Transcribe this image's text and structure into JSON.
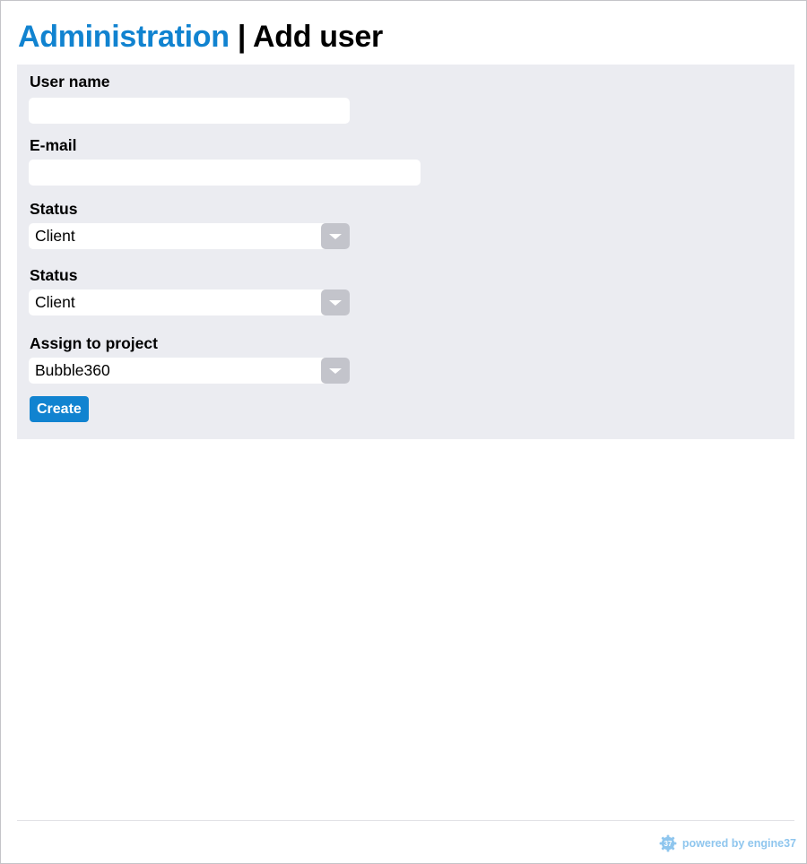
{
  "header": {
    "breadcrumb_root": "Administration",
    "separator": "|",
    "current_page": "Add user"
  },
  "form": {
    "username": {
      "label": "User name",
      "value": "",
      "placeholder": ""
    },
    "email": {
      "label": "E-mail",
      "value": "",
      "placeholder": ""
    },
    "status_1": {
      "label": "Status",
      "selected": "Client"
    },
    "status_2": {
      "label": "Status",
      "selected": "Client"
    },
    "project": {
      "label": "Assign to project",
      "selected": "Bubble360"
    },
    "create_label": "Create"
  },
  "footer": {
    "badge_number": "37",
    "credit_text": "powered by engine37"
  },
  "colors": {
    "accent": "#1183d0",
    "panel_bg": "#ebecf1",
    "select_button": "#c3c4cb",
    "footer_text": "#8fc6ee"
  },
  "icons": {
    "select_arrow": "chevron-down-icon",
    "footer_logo": "gear-badge-icon"
  }
}
